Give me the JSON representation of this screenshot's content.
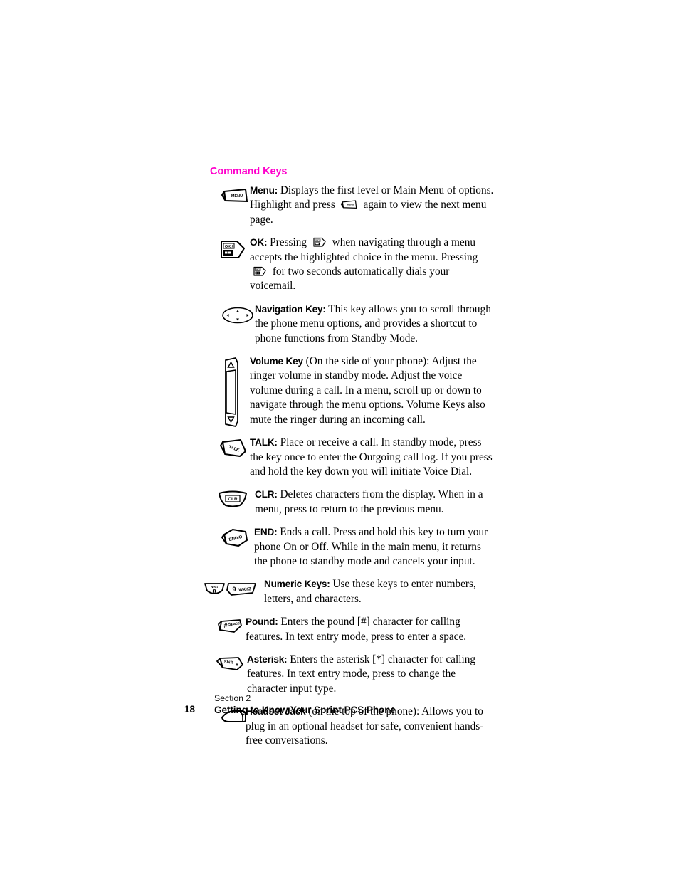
{
  "page": {
    "heading": "Command Keys",
    "number": "18",
    "footer_section": "Section 2",
    "footer_title": "Getting to Know Your Sprint PCS Phone",
    "heading_color": "#ff00cc"
  },
  "entries": [
    {
      "icon": "menu-key-icon",
      "icon_label": "MENU",
      "term": "Menu:",
      "text_1": " Displays the first level or Main Menu of options. Highlight and press ",
      "inline_icon": "menu-key-icon",
      "text_2": " again to view the next menu page."
    },
    {
      "icon": "ok-key-icon",
      "icon_label": "OK",
      "term": "OK:",
      "text_1": " Pressing ",
      "inline_icon": "ok-key-icon",
      "text_2": " when navigating through a menu accepts the highlighted choice in the menu. Pressing ",
      "inline_icon_2": "ok-key-icon",
      "text_3": " for two seconds automatically dials your voicemail."
    },
    {
      "icon": "navigation-key-icon",
      "term": "Navigation Key:",
      "text_1": " This key allows you to scroll through the phone menu options, and provides a shortcut to phone functions from Standby Mode."
    },
    {
      "icon": "volume-key-icon",
      "term": "Volume Key",
      "text_1": " (On the side of your phone): Adjust the ringer volume in standby mode. Adjust the voice volume during a call. In a menu, scroll up or down to navigate through the menu options. Volume Keys also mute the ringer during an incoming call."
    },
    {
      "icon": "talk-key-icon",
      "icon_label": "TALK",
      "term": "TALK:",
      "text_1": " Place or receive a call. In standby mode, press the key once to enter the Outgoing call log. If you press and hold the key down you will initiate Voice Dial."
    },
    {
      "icon": "clr-key-icon",
      "icon_label": "CLR",
      "term": "CLR:",
      "text_1": " Deletes characters from the display. When in a menu, press to return to the previous menu."
    },
    {
      "icon": "end-key-icon",
      "icon_label": "END/ ",
      "term": "END:",
      "text_1": " Ends a call. Press and hold this key to turn your phone On or Off. While in the main menu, it returns the phone to standby mode and cancels your input."
    },
    {
      "icon": "numeric-keys-icon",
      "icon_label": "0",
      "icon_label_sub": "Next",
      "icon_label_2": "9",
      "icon_label_2_sub": "WXYZ",
      "term": "Numeric Keys:",
      "text_1": " Use these keys to enter numbers, letters, and characters."
    },
    {
      "icon": "pound-key-icon",
      "icon_label": "Space",
      "term": "Pound:",
      "text_1": " Enters the pound [#] character for calling features. In text entry mode, press to enter a space."
    },
    {
      "icon": "asterisk-key-icon",
      "icon_label": "Shift",
      "term": "Asterisk:",
      "text_1": " Enters the asterisk [*] character for calling features. In text entry mode, press to change the character input type."
    },
    {
      "icon": "headset-jack-icon",
      "term": "Headset Jack",
      "text_1": " (on the top of the phone): Allows you to plug in an optional headset for safe, convenient hands-free conversations."
    }
  ]
}
